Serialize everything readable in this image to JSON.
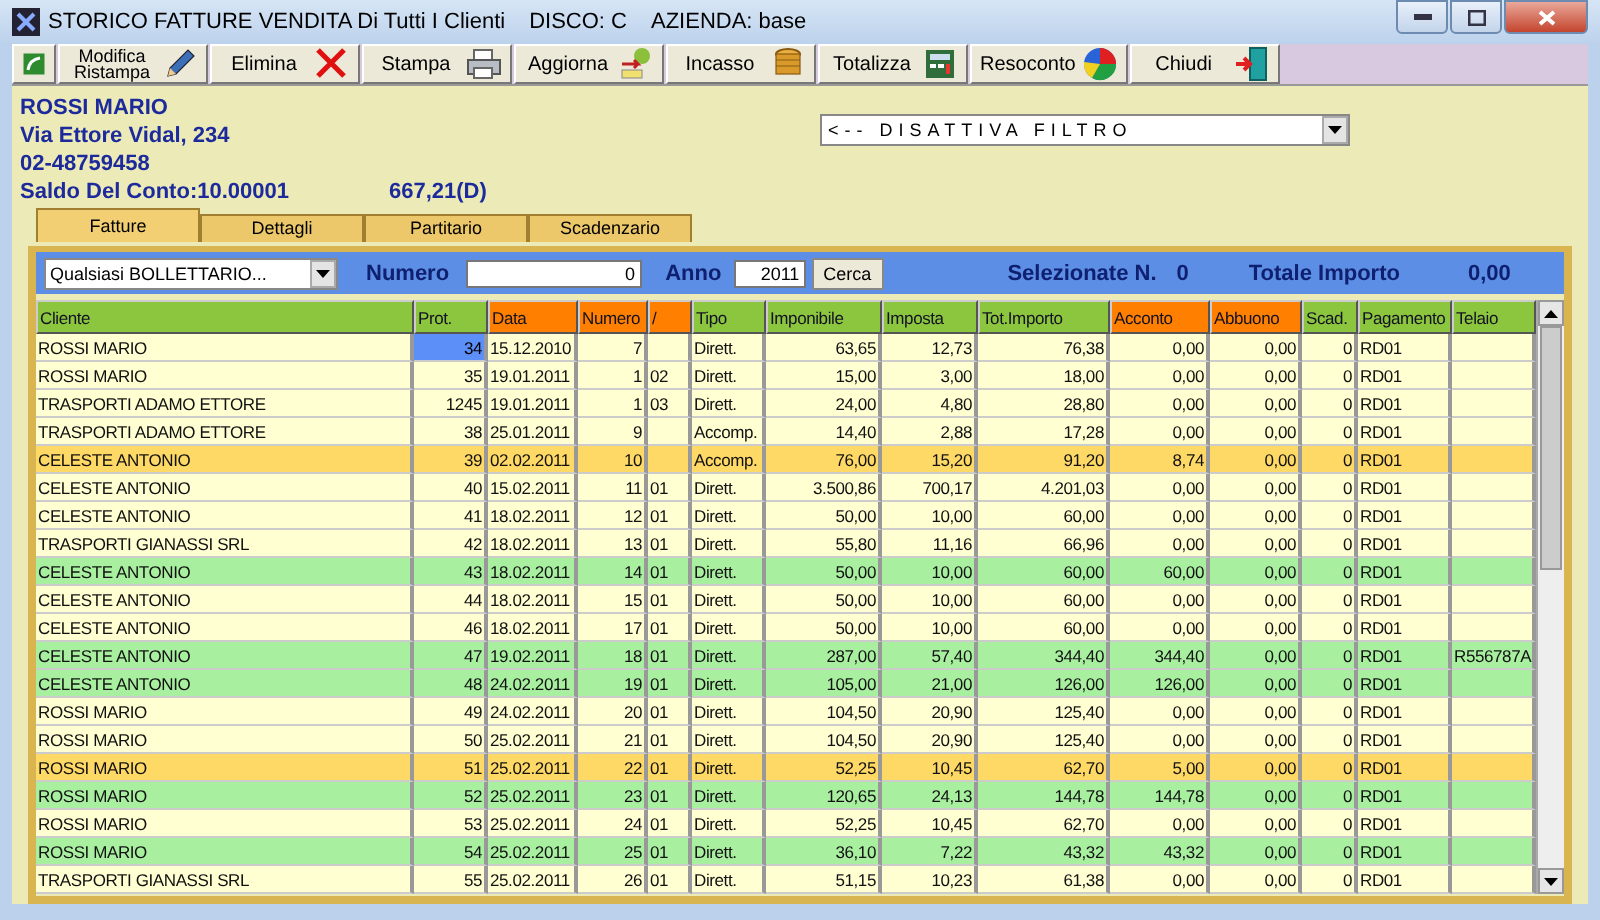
{
  "window": {
    "title": "STORICO FATTURE VENDITA Di Tutti I Clienti",
    "disk": "DISCO: C",
    "company": "AZIENDA: base"
  },
  "toolbar": [
    {
      "kind": "icon"
    },
    {
      "kind": "edit",
      "label": "Modifica Ristampa"
    },
    {
      "kind": "delete",
      "label": "Elimina"
    },
    {
      "kind": "print",
      "label": "Stampa"
    },
    {
      "kind": "refresh",
      "label": "Aggiorna"
    },
    {
      "kind": "cash",
      "label": "Incasso"
    },
    {
      "kind": "total",
      "label": "Totalizza"
    },
    {
      "kind": "report",
      "label": "Resoconto"
    },
    {
      "kind": "exit",
      "label": "Chiudi"
    }
  ],
  "customer": {
    "name": "ROSSI MARIO",
    "address": "Via Ettore Vidal, 234",
    "phone": "02-48759458",
    "balance_label": "Saldo Del Conto:10.00001",
    "balance": "667,21(D)"
  },
  "filter_dropdown": {
    "value": "<-- DISATTIVA FILTRO"
  },
  "tabs": [
    {
      "label": "Fatture",
      "selected": true
    },
    {
      "label": "Dettagli",
      "selected": false
    },
    {
      "label": "Partitario",
      "selected": false
    },
    {
      "label": "Scadenzario",
      "selected": false
    }
  ],
  "filter_bar": {
    "book": "Qualsiasi BOLLETTARIO...",
    "number_label": "Numero",
    "number": "0",
    "year_label": "Anno",
    "year": "2011",
    "search_button": "Cerca",
    "selected_label": "Selezionate N.",
    "selected_count": "0",
    "total_label": "Totale Importo",
    "total": "0,00"
  },
  "table": {
    "columns": [
      {
        "label": "Cliente",
        "color": "#8cc63e"
      },
      {
        "label": "Prot.",
        "color": "#8cc63e"
      },
      {
        "label": "Data",
        "color": "#ff7f00"
      },
      {
        "label": "Numero",
        "color": "#ff7f00"
      },
      {
        "label": "/",
        "color": "#ff7f00"
      },
      {
        "label": "Tipo",
        "color": "#8cc63e"
      },
      {
        "label": "Imponibile",
        "color": "#8cc63e"
      },
      {
        "label": "Imposta",
        "color": "#8cc63e"
      },
      {
        "label": "Tot.Importo",
        "color": "#8cc63e"
      },
      {
        "label": "Acconto",
        "color": "#ff7f00"
      },
      {
        "label": "Abbuono",
        "color": "#ff7f00"
      },
      {
        "label": "Scad.",
        "color": "#8cc63e"
      },
      {
        "label": "Pagamento",
        "color": "#8cc63e"
      },
      {
        "label": "Telaio",
        "color": "#8cc63e"
      }
    ],
    "rows": [
      {
        "color": "#ffffd2",
        "selected": true,
        "cells": [
          "ROSSI MARIO",
          "34",
          "15.12.2010",
          "7",
          "",
          "Dirett.",
          "63,65",
          "12,73",
          "76,38",
          "0,00",
          "0,00",
          "0",
          "RD01",
          ""
        ]
      },
      {
        "color": "#ffffd2",
        "selected": false,
        "cells": [
          "ROSSI MARIO",
          "35",
          "19.01.2011",
          "1",
          "02",
          "Dirett.",
          "15,00",
          "3,00",
          "18,00",
          "0,00",
          "0,00",
          "0",
          "RD01",
          ""
        ]
      },
      {
        "color": "#ffffd2",
        "selected": false,
        "cells": [
          "TRASPORTI ADAMO ETTORE",
          "1245",
          "19.01.2011",
          "1",
          "03",
          "Dirett.",
          "24,00",
          "4,80",
          "28,80",
          "0,00",
          "0,00",
          "0",
          "RD01",
          ""
        ]
      },
      {
        "color": "#ffffd2",
        "selected": false,
        "cells": [
          "TRASPORTI ADAMO ETTORE",
          "38",
          "25.01.2011",
          "9",
          "",
          "Accomp.",
          "14,40",
          "2,88",
          "17,28",
          "0,00",
          "0,00",
          "0",
          "RD01",
          ""
        ]
      },
      {
        "color": "#ffd966",
        "selected": false,
        "cells": [
          "CELESTE ANTONIO",
          "39",
          "02.02.2011",
          "10",
          "",
          "Accomp.",
          "76,00",
          "15,20",
          "91,20",
          "8,74",
          "0,00",
          "0",
          "RD01",
          ""
        ]
      },
      {
        "color": "#ffffd2",
        "selected": false,
        "cells": [
          "CELESTE ANTONIO",
          "40",
          "15.02.2011",
          "11",
          "01",
          "Dirett.",
          "3.500,86",
          "700,17",
          "4.201,03",
          "0,00",
          "0,00",
          "0",
          "RD01",
          ""
        ]
      },
      {
        "color": "#ffffd2",
        "selected": false,
        "cells": [
          "CELESTE ANTONIO",
          "41",
          "18.02.2011",
          "12",
          "01",
          "Dirett.",
          "50,00",
          "10,00",
          "60,00",
          "0,00",
          "0,00",
          "0",
          "RD01",
          ""
        ]
      },
      {
        "color": "#ffffd2",
        "selected": false,
        "cells": [
          "TRASPORTI GIANASSI SRL",
          "42",
          "18.02.2011",
          "13",
          "01",
          "Dirett.",
          "55,80",
          "11,16",
          "66,96",
          "0,00",
          "0,00",
          "0",
          "RD01",
          ""
        ]
      },
      {
        "color": "#a8f0a0",
        "selected": false,
        "cells": [
          "CELESTE ANTONIO",
          "43",
          "18.02.2011",
          "14",
          "01",
          "Dirett.",
          "50,00",
          "10,00",
          "60,00",
          "60,00",
          "0,00",
          "0",
          "RD01",
          ""
        ]
      },
      {
        "color": "#ffffd2",
        "selected": false,
        "cells": [
          "CELESTE ANTONIO",
          "44",
          "18.02.2011",
          "15",
          "01",
          "Dirett.",
          "50,00",
          "10,00",
          "60,00",
          "0,00",
          "0,00",
          "0",
          "RD01",
          ""
        ]
      },
      {
        "color": "#ffffd2",
        "selected": false,
        "cells": [
          "CELESTE ANTONIO",
          "46",
          "18.02.2011",
          "17",
          "01",
          "Dirett.",
          "50,00",
          "10,00",
          "60,00",
          "0,00",
          "0,00",
          "0",
          "RD01",
          ""
        ]
      },
      {
        "color": "#a8f0a0",
        "selected": false,
        "cells": [
          "CELESTE ANTONIO",
          "47",
          "19.02.2011",
          "18",
          "01",
          "Dirett.",
          "287,00",
          "57,40",
          "344,40",
          "344,40",
          "0,00",
          "0",
          "RD01",
          "R556787A"
        ]
      },
      {
        "color": "#a8f0a0",
        "selected": false,
        "cells": [
          "CELESTE ANTONIO",
          "48",
          "24.02.2011",
          "19",
          "01",
          "Dirett.",
          "105,00",
          "21,00",
          "126,00",
          "126,00",
          "0,00",
          "0",
          "RD01",
          ""
        ]
      },
      {
        "color": "#ffffd2",
        "selected": false,
        "cells": [
          "ROSSI MARIO",
          "49",
          "24.02.2011",
          "20",
          "01",
          "Dirett.",
          "104,50",
          "20,90",
          "125,40",
          "0,00",
          "0,00",
          "0",
          "RD01",
          ""
        ]
      },
      {
        "color": "#ffffd2",
        "selected": false,
        "cells": [
          "ROSSI MARIO",
          "50",
          "25.02.2011",
          "21",
          "01",
          "Dirett.",
          "104,50",
          "20,90",
          "125,40",
          "0,00",
          "0,00",
          "0",
          "RD01",
          ""
        ]
      },
      {
        "color": "#ffd966",
        "selected": false,
        "cells": [
          "ROSSI MARIO",
          "51",
          "25.02.2011",
          "22",
          "01",
          "Dirett.",
          "52,25",
          "10,45",
          "62,70",
          "5,00",
          "0,00",
          "0",
          "RD01",
          ""
        ]
      },
      {
        "color": "#a8f0a0",
        "selected": false,
        "cells": [
          "ROSSI MARIO",
          "52",
          "25.02.2011",
          "23",
          "01",
          "Dirett.",
          "120,65",
          "24,13",
          "144,78",
          "144,78",
          "0,00",
          "0",
          "RD01",
          ""
        ]
      },
      {
        "color": "#ffffd2",
        "selected": false,
        "cells": [
          "ROSSI MARIO",
          "53",
          "25.02.2011",
          "24",
          "01",
          "Dirett.",
          "52,25",
          "10,45",
          "62,70",
          "0,00",
          "0,00",
          "0",
          "RD01",
          ""
        ]
      },
      {
        "color": "#a8f0a0",
        "selected": false,
        "cells": [
          "ROSSI MARIO",
          "54",
          "25.02.2011",
          "25",
          "01",
          "Dirett.",
          "36,10",
          "7,22",
          "43,32",
          "43,32",
          "0,00",
          "0",
          "RD01",
          ""
        ]
      },
      {
        "color": "#ffffd2",
        "selected": false,
        "cells": [
          "TRASPORTI GIANASSI SRL",
          "55",
          "25.02.2011",
          "26",
          "01",
          "Dirett.",
          "51,15",
          "10,23",
          "61,38",
          "0,00",
          "0,00",
          "0",
          "RD01",
          ""
        ]
      }
    ]
  }
}
